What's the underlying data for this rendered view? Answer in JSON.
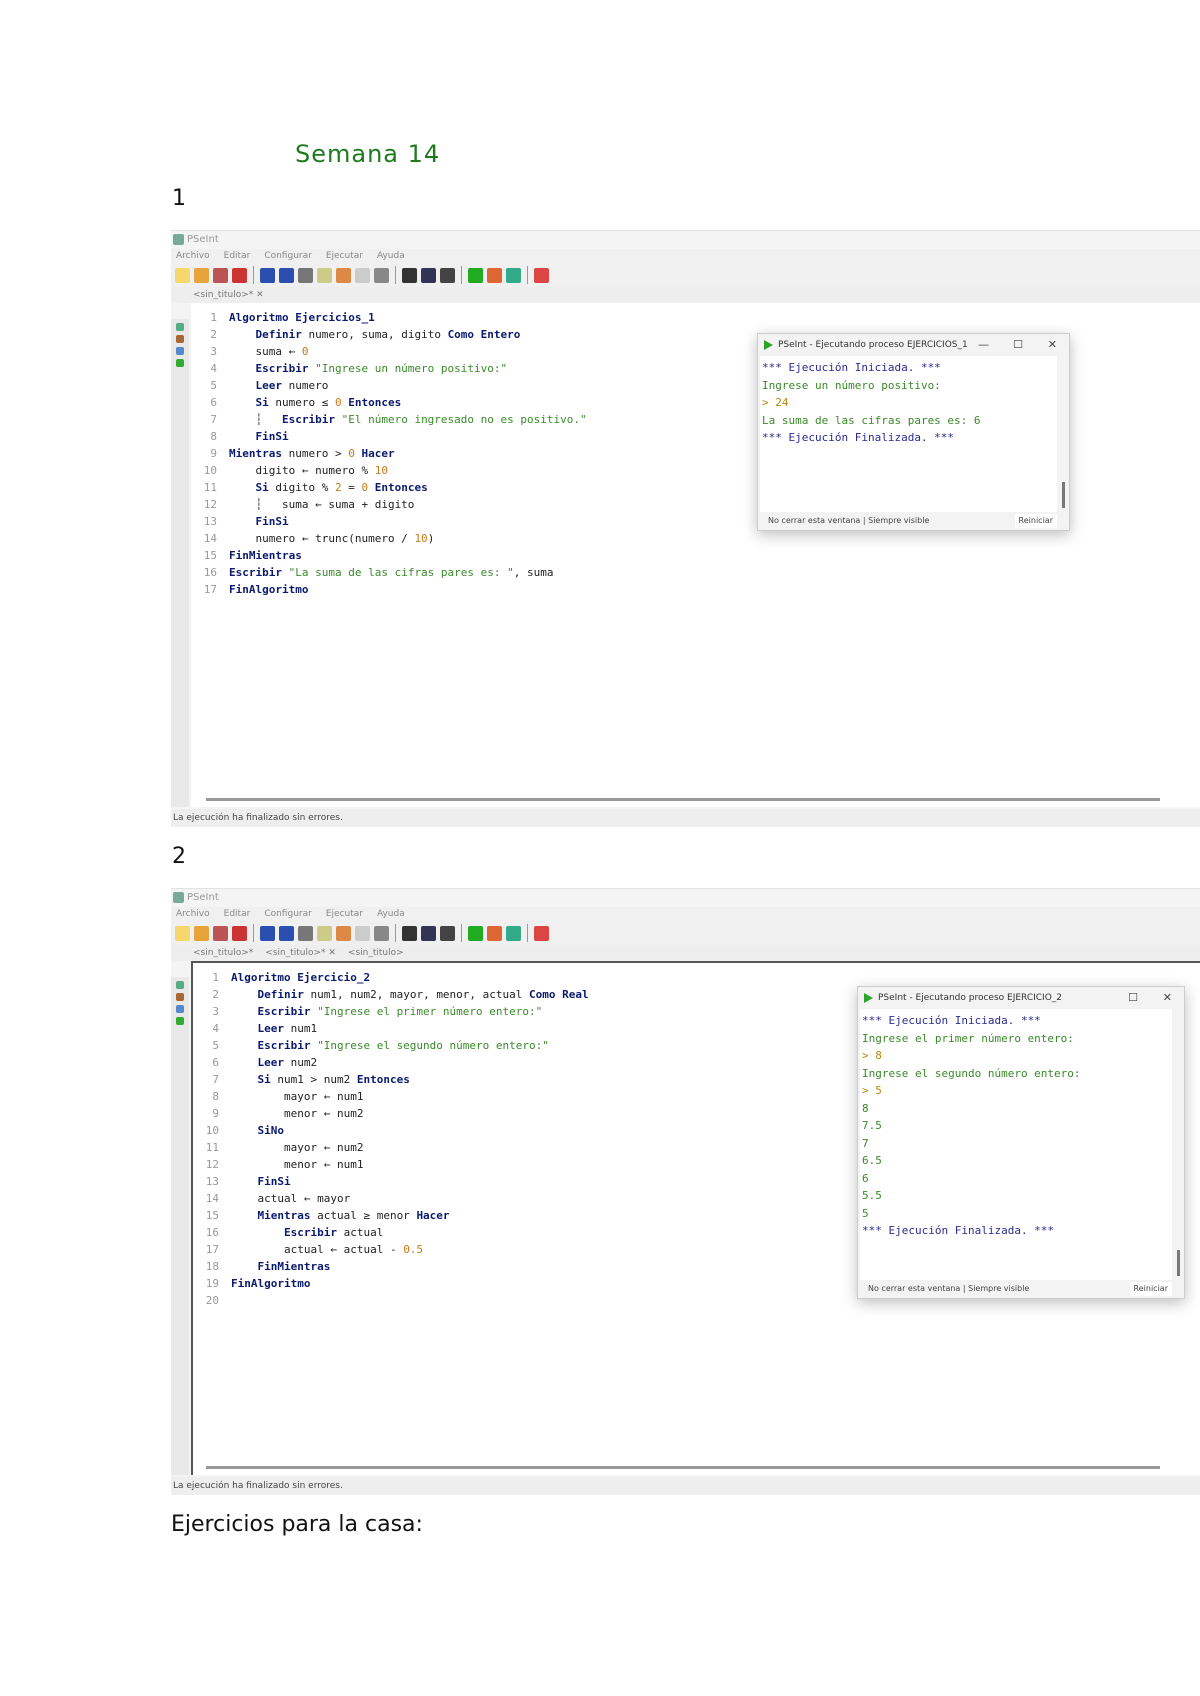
{
  "document": {
    "title": "Semana 14",
    "section1": "1",
    "section2": "2",
    "homework": "Ejercicios para la casa:"
  },
  "shot1": {
    "app_title": "PSeInt",
    "menu": [
      "Archivo",
      "Editar",
      "Configurar",
      "Ejecutar",
      "Ayuda"
    ],
    "tabs": [
      "<sin_titulo>* ✕"
    ],
    "status": "La ejecución ha finalizado sin errores.",
    "code": [
      [
        [
          "Algoritmo Ejercicios_1",
          "kw"
        ]
      ],
      [
        [
          "    Definir ",
          "kw"
        ],
        [
          "numero, suma, digito ",
          "id"
        ],
        [
          "Como Entero",
          "kw"
        ]
      ],
      [
        [
          "    suma ",
          "id"
        ],
        [
          "← ",
          "op"
        ],
        [
          "0",
          "nm"
        ]
      ],
      [
        [
          "    Escribir ",
          "kw"
        ],
        [
          "\"Ingrese un número positivo:\"",
          "st"
        ]
      ],
      [
        [
          "    Leer ",
          "kw"
        ],
        [
          "numero",
          "id"
        ]
      ],
      [
        [
          "    Si ",
          "kw"
        ],
        [
          "numero ≤ ",
          "id"
        ],
        [
          "0 ",
          "nm"
        ],
        [
          "Entonces",
          "kw"
        ]
      ],
      [
        [
          "    ┆   ",
          "id"
        ],
        [
          "Escribir ",
          "kw"
        ],
        [
          "\"El número ingresado no es positivo.\"",
          "st"
        ]
      ],
      [
        [
          "    FinSi",
          "kw"
        ]
      ],
      [
        [
          "Mientras ",
          "kw"
        ],
        [
          "numero > ",
          "id"
        ],
        [
          "0 ",
          "nm"
        ],
        [
          "Hacer",
          "kw"
        ]
      ],
      [
        [
          "    digito ← numero % ",
          "id"
        ],
        [
          "10",
          "nm"
        ]
      ],
      [
        [
          "    Si ",
          "kw"
        ],
        [
          "digito % ",
          "id"
        ],
        [
          "2 ",
          "nm"
        ],
        [
          "= ",
          "op"
        ],
        [
          "0 ",
          "nm"
        ],
        [
          "Entonces",
          "kw"
        ]
      ],
      [
        [
          "    ┆   suma ← suma + digito",
          "id"
        ]
      ],
      [
        [
          "    FinSi",
          "kw"
        ]
      ],
      [
        [
          "    numero ← trunc(numero / ",
          "id"
        ],
        [
          "10",
          "nm"
        ],
        [
          ")",
          "id"
        ]
      ],
      [
        [
          "FinMientras",
          "kw"
        ]
      ],
      [
        [
          "Escribir ",
          "kw"
        ],
        [
          "\"La suma de las cifras pares es: \"",
          "st"
        ],
        [
          ", suma",
          "id"
        ]
      ],
      [
        [
          "FinAlgoritmo",
          "kw"
        ]
      ]
    ],
    "console": {
      "title": "PSeInt - Ejecutando proceso EJERCICIOS_1",
      "lines": [
        [
          "*** Ejecución Iniciada. ***",
          "sys"
        ],
        [
          "Ingrese un número positivo:",
          "out"
        ],
        [
          "> 24",
          "inp"
        ],
        [
          "La suma de las cifras pares es: 6",
          "out"
        ],
        [
          "*** Ejecución Finalizada. ***",
          "sys"
        ]
      ],
      "footer_check": "No cerrar esta ventana",
      "footer_check2": "Siempre visible",
      "close_button": "Reiniciar"
    }
  },
  "shot2": {
    "app_title": "PSeInt",
    "menu": [
      "Archivo",
      "Editar",
      "Configurar",
      "Ejecutar",
      "Ayuda"
    ],
    "tabs": [
      "<sin_titulo>*",
      "<sin_titulo>* ✕",
      "<sin_titulo>"
    ],
    "status": "La ejecución ha finalizado sin errores.",
    "code": [
      [
        [
          "Algoritmo Ejercicio_2",
          "kw"
        ]
      ],
      [
        [
          "    Definir ",
          "kw"
        ],
        [
          "num1, num2, mayor, menor, actual ",
          "id"
        ],
        [
          "Como Real",
          "kw"
        ]
      ],
      [
        [
          "    Escribir ",
          "kw"
        ],
        [
          "\"Ingrese el primer número entero:\"",
          "st"
        ]
      ],
      [
        [
          "    Leer ",
          "kw"
        ],
        [
          "num1",
          "id"
        ]
      ],
      [
        [
          "    Escribir ",
          "kw"
        ],
        [
          "\"Ingrese el segundo número entero:\"",
          "st"
        ]
      ],
      [
        [
          "    Leer ",
          "kw"
        ],
        [
          "num2",
          "id"
        ]
      ],
      [
        [
          "    Si ",
          "kw"
        ],
        [
          "num1 > num2 ",
          "id"
        ],
        [
          "Entonces",
          "kw"
        ]
      ],
      [
        [
          "        mayor ← num1",
          "id"
        ]
      ],
      [
        [
          "        menor ← num2",
          "id"
        ]
      ],
      [
        [
          "    SiNo",
          "kw"
        ]
      ],
      [
        [
          "        mayor ← num2",
          "id"
        ]
      ],
      [
        [
          "        menor ← num1",
          "id"
        ]
      ],
      [
        [
          "    FinSi",
          "kw"
        ]
      ],
      [
        [
          "    actual ← mayor",
          "id"
        ]
      ],
      [
        [
          "    Mientras ",
          "kw"
        ],
        [
          "actual ≥ menor ",
          "id"
        ],
        [
          "Hacer",
          "kw"
        ]
      ],
      [
        [
          "        Escribir ",
          "kw"
        ],
        [
          "actual",
          "id"
        ]
      ],
      [
        [
          "        actual ← actual - ",
          "id"
        ],
        [
          "0.5",
          "nm"
        ]
      ],
      [
        [
          "    FinMientras",
          "kw"
        ]
      ],
      [
        [
          "FinAlgoritmo",
          "kw"
        ]
      ],
      []
    ],
    "console": {
      "title": "PSeInt - Ejecutando proceso EJERCICIO_2",
      "lines": [
        [
          "*** Ejecución Iniciada. ***",
          "sys"
        ],
        [
          "Ingrese el primer número entero:",
          "out"
        ],
        [
          "> 8",
          "inp"
        ],
        [
          "Ingrese el segundo número entero:",
          "out"
        ],
        [
          "> 5",
          "inp"
        ],
        [
          "8",
          "out"
        ],
        [
          "7.5",
          "out"
        ],
        [
          "7",
          "out"
        ],
        [
          "6.5",
          "out"
        ],
        [
          "6",
          "out"
        ],
        [
          "5.5",
          "out"
        ],
        [
          "5",
          "out"
        ],
        [
          "*** Ejecución Finalizada. ***",
          "sys"
        ]
      ],
      "footer_check": "No cerrar esta ventana",
      "footer_check2": "Siempre visible",
      "close_button": "Reiniciar"
    }
  },
  "colors": {
    "title": "#1e7a1e",
    "keyword": "#0b1a6e",
    "string": "#3a8a2a",
    "number": "#c87a1a"
  }
}
